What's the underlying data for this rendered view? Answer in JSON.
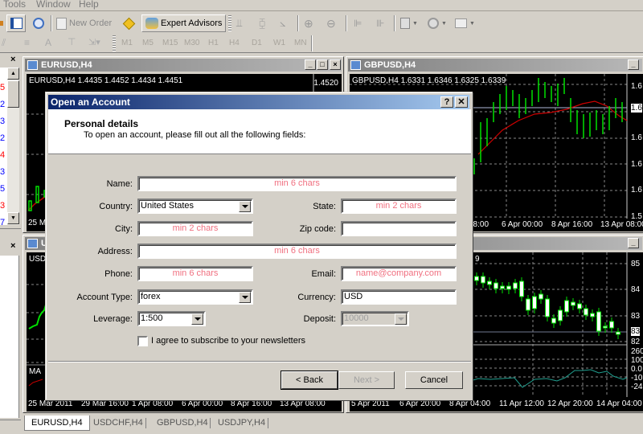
{
  "menu": {
    "items": [
      "Tools",
      "Window",
      "Help"
    ]
  },
  "toolbar": {
    "new_order_label": "New Order",
    "expert_advisors_label": "Expert Advisors",
    "icons": [
      "profiles-icon",
      "navigator-icon",
      "data-window-icon",
      "new-order-icon",
      "alert-icon",
      "expert-advisors-icon",
      "bar-chart-icon",
      "candlestick-icon",
      "line-chart-icon",
      "zoom-in-icon",
      "zoom-out-icon",
      "chart-shift-icon",
      "autoscroll-icon",
      "indicators-icon",
      "periods-icon",
      "templates-icon"
    ],
    "drawing_icons": [
      "fibonacci-icon",
      "horizontal-lines-icon",
      "text-icon",
      "text-label-icon",
      "arrows-icon"
    ],
    "timeframes": [
      "M1",
      "M5",
      "M15",
      "M30",
      "H1",
      "H4",
      "D1",
      "W1",
      "MN"
    ]
  },
  "left_panel": {
    "values_color": [
      "#ff0000",
      "#0000ff",
      "#0000ff",
      "#0000ff",
      "#ff0000",
      "#0000ff",
      "#0000ff",
      "#ff0000",
      "#0000ff"
    ],
    "values_text": [
      "5",
      "2",
      "3",
      "2",
      "4",
      "3",
      "5",
      "3",
      "7"
    ]
  },
  "charts": [
    {
      "title": "EURUSD,H4",
      "header": "EURUSD,H4  1.4435 1.4452 1.4434 1.4451",
      "price_label": "1.4520",
      "time_axis": [
        "25 Mar 2011",
        "29 Mar 16:00",
        "1 Apr 08:00",
        "6 Apr 00:00",
        "8 Apr 16:00",
        "13 Apr 08:00"
      ],
      "indicator_label": "MA"
    },
    {
      "title": "GBPUSD,H4",
      "header": "GBPUSD,H4  1.6331 1.6346 1.6325 1.6339",
      "time_axis": [
        "08:00",
        "6 Apr 00:00",
        "8 Apr 16:00",
        "13 Apr 08:00"
      ],
      "price_axis": [
        "1.6",
        "1.6",
        "1.6",
        "1.6",
        "1.6",
        "1.5"
      ]
    },
    {
      "title": "USDCHF,H4",
      "header": "USD"
    },
    {
      "title": "USDJPY,H4",
      "header": "9",
      "price_axis": [
        "85",
        "84",
        "83",
        "83",
        "82"
      ],
      "indicator_axis": [
        "260",
        "100",
        "0.0",
        "-10",
        "-24"
      ],
      "time_axis": [
        "5 Apr 2011",
        "6 Apr 20:00",
        "8 Apr 04:00",
        "11 Apr 12:00",
        "12 Apr 20:00",
        "14 Apr 04:00"
      ]
    }
  ],
  "tabs": [
    "EURUSD,H4",
    "USDCHF,H4",
    "GBPUSD,H4",
    "USDJPY,H4"
  ],
  "dialog": {
    "title": "Open an Account",
    "help_label": "?",
    "close_label": "✕",
    "heading": "Personal details",
    "subheading": "To open an account, please fill out all the following fields:",
    "fields": {
      "name": {
        "label": "Name:",
        "value": "",
        "placeholder": "min 6 chars"
      },
      "country": {
        "label": "Country:",
        "value": "United States"
      },
      "state": {
        "label": "State:",
        "value": "",
        "placeholder": "min 2 chars"
      },
      "city": {
        "label": "City:",
        "value": "",
        "placeholder": "min 2 chars"
      },
      "zip": {
        "label": "Zip code:",
        "value": ""
      },
      "address": {
        "label": "Address:",
        "value": "",
        "placeholder": "min 6 chars"
      },
      "phone": {
        "label": "Phone:",
        "value": "",
        "placeholder": "min 6 chars"
      },
      "email": {
        "label": "Email:",
        "value": "",
        "placeholder": "name@company.com"
      },
      "account_type": {
        "label": "Account Type:",
        "value": "forex"
      },
      "currency": {
        "label": "Currency:",
        "value": "USD"
      },
      "leverage": {
        "label": "Leverage:",
        "value": "1:500"
      },
      "deposit": {
        "label": "Deposit:",
        "value": "10000"
      }
    },
    "newsletter": {
      "label": "I agree to subscribe to your newsletters",
      "checked": false
    },
    "buttons": {
      "back": "< Back",
      "next": "Next >",
      "cancel": "Cancel"
    }
  }
}
